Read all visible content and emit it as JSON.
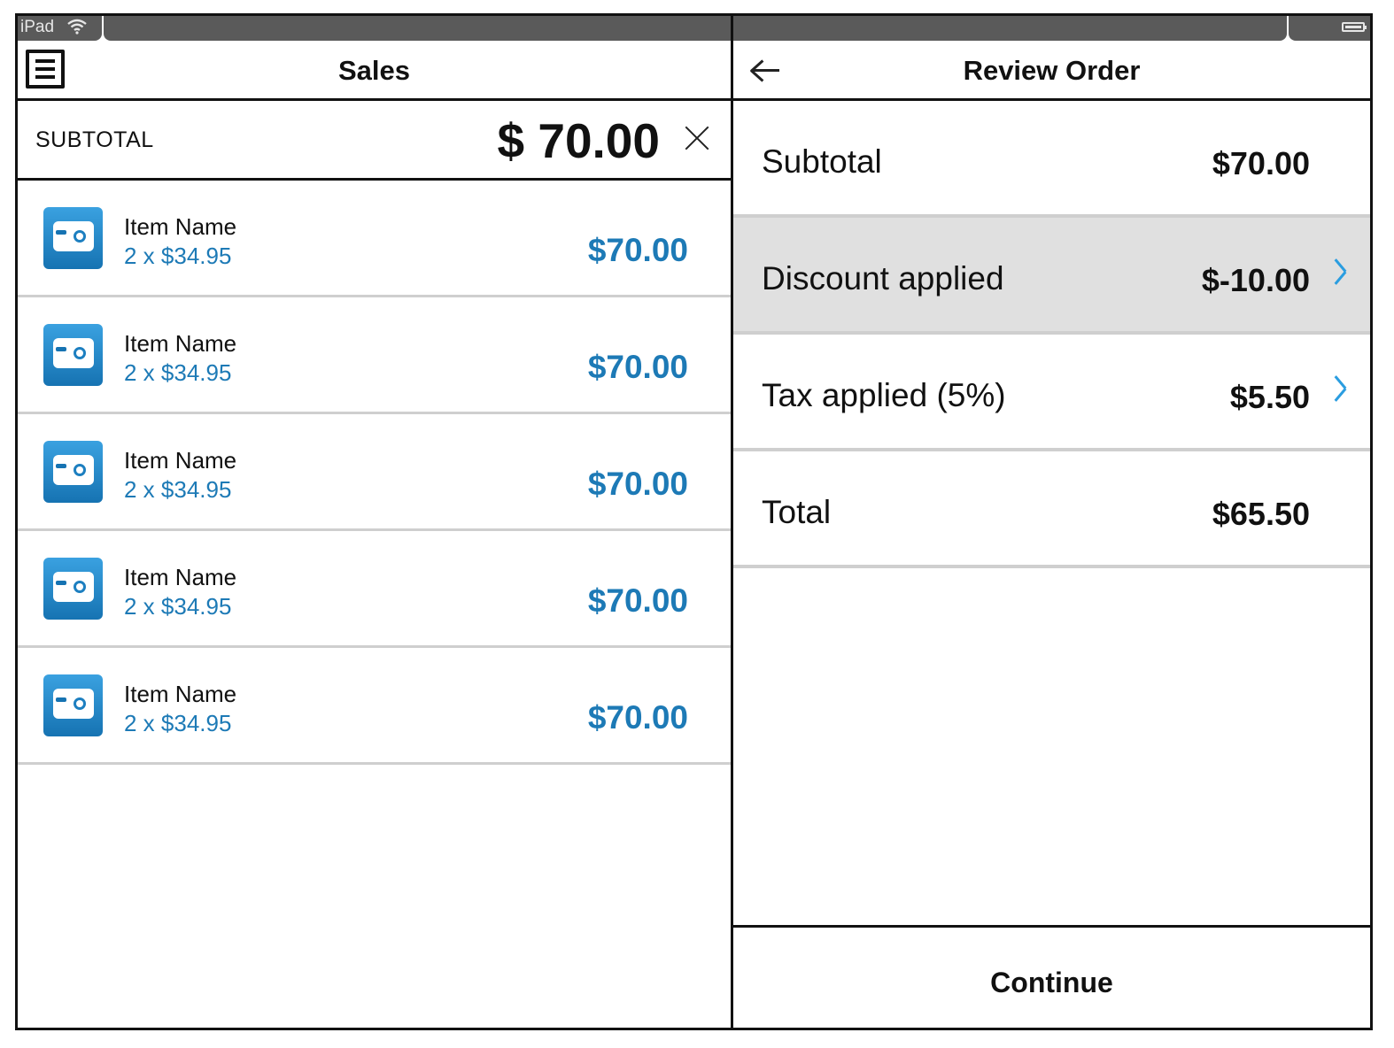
{
  "status_bar": {
    "carrier": "iPad",
    "wifi_icon": "wifi-icon",
    "battery_icon": "battery-icon"
  },
  "sales": {
    "title": "Sales",
    "menu_icon": "menu-icon",
    "subtotal_label": "SUBTOTAL",
    "subtotal_amount": "$ 70.00",
    "close_icon": "close-icon",
    "items": [
      {
        "name": "Item Name",
        "qty": "2 x $34.95",
        "price": "$70.00",
        "icon": "camera-icon"
      },
      {
        "name": "Item Name",
        "qty": "2 x $34.95",
        "price": "$70.00",
        "icon": "camera-icon"
      },
      {
        "name": "Item Name",
        "qty": "2 x $34.95",
        "price": "$70.00",
        "icon": "camera-icon"
      },
      {
        "name": "Item Name",
        "qty": "2 x $34.95",
        "price": "$70.00",
        "icon": "camera-icon"
      },
      {
        "name": "Item Name",
        "qty": "2 x $34.95",
        "price": "$70.00",
        "icon": "camera-icon"
      }
    ]
  },
  "review": {
    "title": "Review Order",
    "back_icon": "back-arrow-icon",
    "rows": [
      {
        "label": "Subtotal",
        "value": "$70.00"
      },
      {
        "label": "Discount applied",
        "value": "$-10.00"
      },
      {
        "label": "Tax applied (5%)",
        "value": "$5.50"
      },
      {
        "label": "Total",
        "value": "$65.50"
      }
    ],
    "continue_label": "Continue"
  },
  "colors": {
    "accent": "#1d7ab6",
    "chevron": "#2a9de0",
    "highlight_row": "#e0e0e0",
    "status_bar": "#5a5a5a"
  }
}
